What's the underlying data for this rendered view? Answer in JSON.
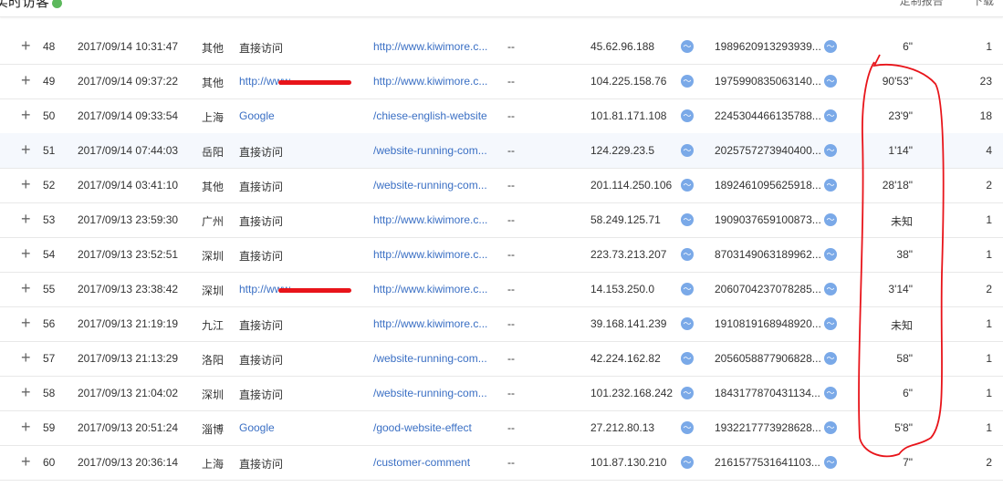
{
  "header": {
    "title": "实时访客",
    "actions": [
      "定制报告",
      "下载"
    ],
    "status_color": "#5cb85c"
  },
  "rows": [
    {
      "id": "48",
      "time": "2017/09/14 10:31:47",
      "region": "其他",
      "source": "直接访问",
      "source_link": false,
      "page": "http://www.kiwimore.c...",
      "keyword": "--",
      "ip": "45.62.96.188",
      "visitor": "1989620913293939...",
      "duration": "6\"",
      "pages": "1"
    },
    {
      "id": "49",
      "time": "2017/09/14 09:37:22",
      "region": "其他",
      "source": "http://www",
      "source_link": true,
      "redacted": true,
      "page": "http://www.kiwimore.c...",
      "keyword": "--",
      "ip": "104.225.158.76",
      "visitor": "1975990835063140...",
      "duration": "90'53\"",
      "pages": "23"
    },
    {
      "id": "50",
      "time": "2017/09/14 09:33:54",
      "region": "上海",
      "source": "Google",
      "source_link": true,
      "page": "/chiese-english-website",
      "keyword": "--",
      "ip": "101.81.171.108",
      "visitor": "2245304466135788...",
      "duration": "23'9\"",
      "pages": "18"
    },
    {
      "id": "51",
      "time": "2017/09/14 07:44:03",
      "region": "岳阳",
      "source": "直接访问",
      "source_link": false,
      "page": "/website-running-com...",
      "keyword": "--",
      "ip": "124.229.23.5",
      "visitor": "2025757273940400...",
      "duration": "1'14\"",
      "pages": "4"
    },
    {
      "id": "52",
      "time": "2017/09/14 03:41:10",
      "region": "其他",
      "source": "直接访问",
      "source_link": false,
      "page": "/website-running-com...",
      "keyword": "--",
      "ip": "201.114.250.106",
      "visitor": "1892461095625918...",
      "duration": "28'18\"",
      "pages": "2"
    },
    {
      "id": "53",
      "time": "2017/09/13 23:59:30",
      "region": "广州",
      "source": "直接访问",
      "source_link": false,
      "page": "http://www.kiwimore.c...",
      "keyword": "--",
      "ip": "58.249.125.71",
      "visitor": "1909037659100873...",
      "duration": "未知",
      "pages": "1"
    },
    {
      "id": "54",
      "time": "2017/09/13 23:52:51",
      "region": "深圳",
      "source": "直接访问",
      "source_link": false,
      "page": "http://www.kiwimore.c...",
      "keyword": "--",
      "ip": "223.73.213.207",
      "visitor": "8703149063189962...",
      "duration": "38\"",
      "pages": "1"
    },
    {
      "id": "55",
      "time": "2017/09/13 23:38:42",
      "region": "深圳",
      "source": "http://www...",
      "source_link": true,
      "redacted": true,
      "page": "http://www.kiwimore.c...",
      "keyword": "--",
      "ip": "14.153.250.0",
      "visitor": "2060704237078285...",
      "duration": "3'14\"",
      "pages": "2"
    },
    {
      "id": "56",
      "time": "2017/09/13 21:19:19",
      "region": "九江",
      "source": "直接访问",
      "source_link": false,
      "page": "http://www.kiwimore.c...",
      "keyword": "--",
      "ip": "39.168.141.239",
      "visitor": "1910819168948920...",
      "duration": "未知",
      "pages": "1"
    },
    {
      "id": "57",
      "time": "2017/09/13 21:13:29",
      "region": "洛阳",
      "source": "直接访问",
      "source_link": false,
      "page": "/website-running-com...",
      "keyword": "--",
      "ip": "42.224.162.82",
      "visitor": "2056058877906828...",
      "duration": "58\"",
      "pages": "1"
    },
    {
      "id": "58",
      "time": "2017/09/13 21:04:02",
      "region": "深圳",
      "source": "直接访问",
      "source_link": false,
      "page": "/website-running-com...",
      "keyword": "--",
      "ip": "101.232.168.242",
      "visitor": "1843177870431134...",
      "duration": "6\"",
      "pages": "1"
    },
    {
      "id": "59",
      "time": "2017/09/13 20:51:24",
      "region": "淄博",
      "source": "Google",
      "source_link": true,
      "page": "/good-website-effect",
      "keyword": "--",
      "ip": "27.212.80.13",
      "visitor": "1932217773928628...",
      "duration": "5'8\"",
      "pages": "1"
    },
    {
      "id": "60",
      "time": "2017/09/13 20:36:14",
      "region": "上海",
      "source": "直接访问",
      "source_link": false,
      "page": "/customer-comment",
      "keyword": "--",
      "ip": "101.87.130.210",
      "visitor": "2161577531641103...",
      "duration": "7\"",
      "pages": "2"
    }
  ],
  "annotation_color": "#e8141a"
}
